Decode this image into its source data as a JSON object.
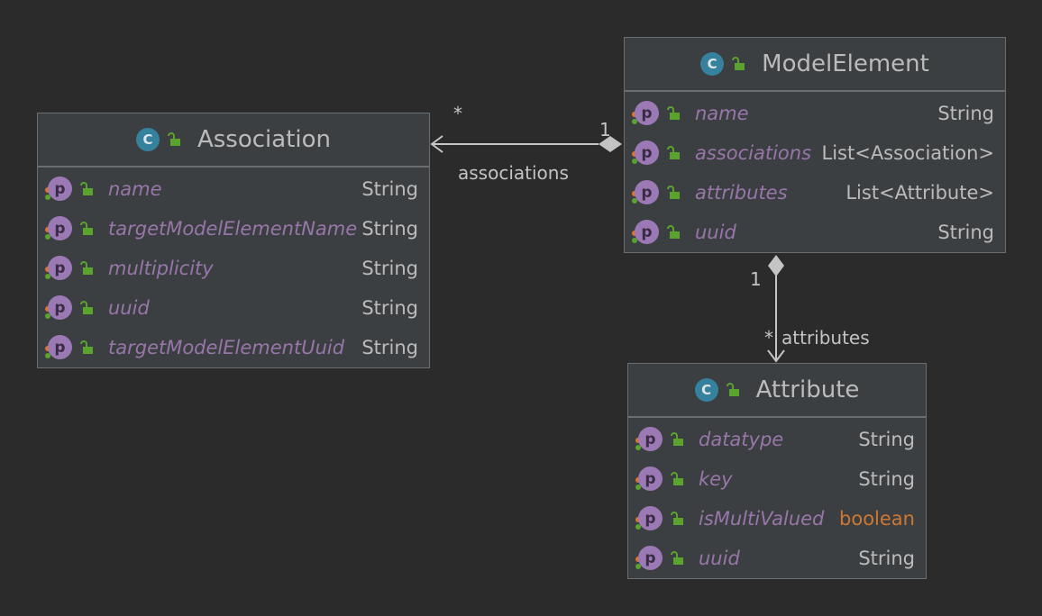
{
  "classes": {
    "association": {
      "icon": "C",
      "title": "Association",
      "fields": [
        {
          "name": "name",
          "type": "String"
        },
        {
          "name": "targetModelElementName",
          "type": "String"
        },
        {
          "name": "multiplicity",
          "type": "String"
        },
        {
          "name": "uuid",
          "type": "String"
        },
        {
          "name": "targetModelElementUuid",
          "type": "String"
        }
      ]
    },
    "model_element": {
      "icon": "C",
      "title": "ModelElement",
      "fields": [
        {
          "name": "name",
          "type": "String"
        },
        {
          "name": "associations",
          "type": "List<Association>"
        },
        {
          "name": "attributes",
          "type": "List<Attribute>"
        },
        {
          "name": "uuid",
          "type": "String"
        }
      ]
    },
    "attribute": {
      "icon": "C",
      "title": "Attribute",
      "fields": [
        {
          "name": "datatype",
          "type": "String"
        },
        {
          "name": "key",
          "type": "String"
        },
        {
          "name": "isMultiValued",
          "type": "boolean"
        },
        {
          "name": "uuid",
          "type": "String"
        }
      ]
    }
  },
  "property_icon_letter": "p",
  "relations": {
    "associations": {
      "label": "associations",
      "source_multiplicity": "1",
      "target_multiplicity": "*"
    },
    "attributes": {
      "label": "attributes",
      "source_multiplicity": "1",
      "target_multiplicity": "*"
    }
  },
  "colors": {
    "background": "#2b2b2b",
    "class_fill": "#3c3f41",
    "class_icon": "#36819e",
    "property_icon": "#9b79b5",
    "field_name": "#9876aa",
    "type_text": "#bbbbbb",
    "keyword_type": "#cc7832",
    "lock_icon": "#5aa32f"
  }
}
